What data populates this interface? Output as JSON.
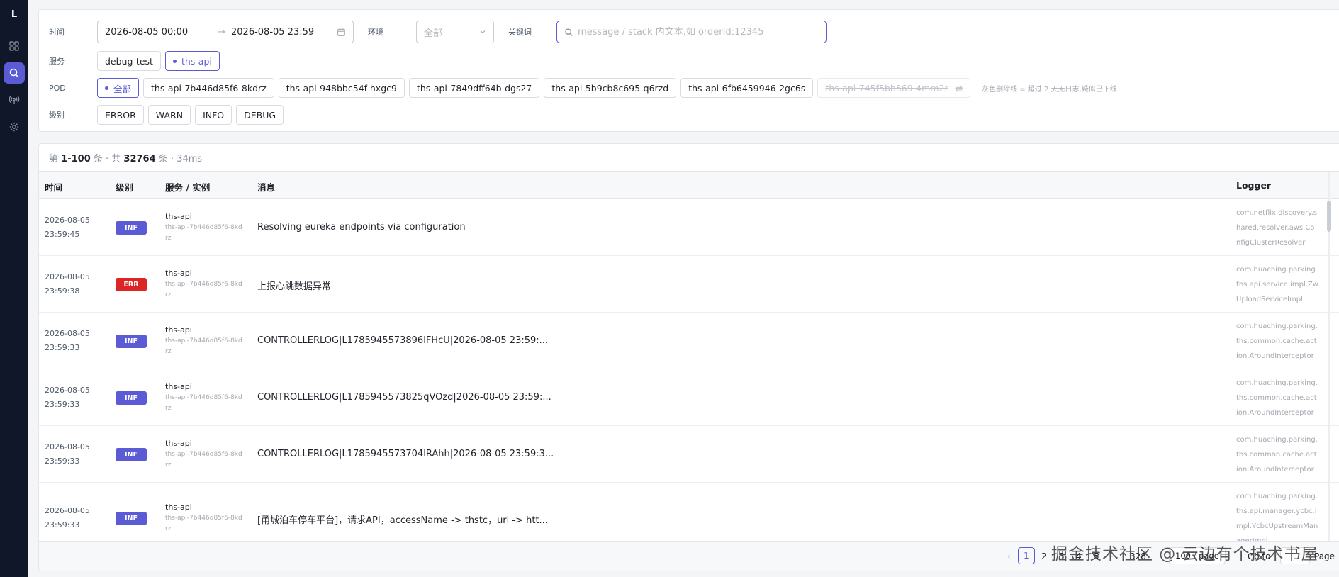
{
  "sidebar": {
    "logo": "L",
    "items": [
      {
        "icon": "grid-icon",
        "active": false
      },
      {
        "icon": "search-icon",
        "active": true
      },
      {
        "icon": "broadcast-icon",
        "active": false
      },
      {
        "icon": "gear-icon",
        "active": false
      }
    ]
  },
  "filters": {
    "time_label": "时间",
    "time_start": "2026-08-05 00:00",
    "time_end": "2026-08-05 23:59",
    "range_arrow": "→",
    "env_label": "环境",
    "env_value": "全部",
    "keyword_label": "关键词",
    "keyword_placeholder": "message / stack 内文本,如 orderId:12345",
    "service_label": "服务",
    "services": [
      {
        "label": "debug-test",
        "active": false
      },
      {
        "label": "ths-api",
        "active": true
      }
    ],
    "pod_label": "POD",
    "pods": [
      {
        "label": "全部",
        "active": true
      },
      {
        "label": "ths-api-7b446d85f6-8kdrz",
        "active": false
      },
      {
        "label": "ths-api-948bbc54f-hxgc9",
        "active": false
      },
      {
        "label": "ths-api-7849dff64b-dgs27",
        "active": false
      },
      {
        "label": "ths-api-5b9cb8c695-q6rzd",
        "active": false
      },
      {
        "label": "ths-api-6fb6459946-2gc6s",
        "active": false
      }
    ],
    "pod_faded": "ths-api-745f5bb569-4mm2r",
    "pod_hint": "灰色删除线 = 超过 2 天无日志,疑似已下线",
    "level_label": "级别",
    "levels": [
      "ERROR",
      "WARN",
      "INFO",
      "DEBUG"
    ]
  },
  "summary": {
    "prefix": "第",
    "range": "1-100",
    "mid": "条 · 共",
    "total": "32764",
    "suffix": "条 · 34ms"
  },
  "table": {
    "headers": {
      "time": "时间",
      "level": "级别",
      "service": "服务 / 实例",
      "message": "消息",
      "logger": "Logger"
    },
    "rows": [
      {
        "date": "2026-08-05",
        "clock": "23:59:45",
        "level": "INF",
        "service": "ths-api",
        "instance": "ths-api-7b446d85f6-8kdrz",
        "message": "Resolving eureka endpoints via configuration",
        "logger": "com.netflix.discovery.shared.resolver.aws.ConfigClusterResolver"
      },
      {
        "date": "2026-08-05",
        "clock": "23:59:38",
        "level": "ERR",
        "service": "ths-api",
        "instance": "ths-api-7b446d85f6-8kdrz",
        "message": "上报心跳数据异常",
        "logger": "com.huaching.parking.ths.api.service.impl.ZwUploadServiceImpl"
      },
      {
        "date": "2026-08-05",
        "clock": "23:59:33",
        "level": "INF",
        "service": "ths-api",
        "instance": "ths-api-7b446d85f6-8kdrz",
        "message": "CONTROLLERLOG|L1785945573896lFHcU|2026-08-05 23:59:...",
        "logger": "com.huaching.parking.ths.common.cache.action.AroundInterceptor"
      },
      {
        "date": "2026-08-05",
        "clock": "23:59:33",
        "level": "INF",
        "service": "ths-api",
        "instance": "ths-api-7b446d85f6-8kdrz",
        "message": "CONTROLLERLOG|L1785945573825qVOzd|2026-08-05 23:59:...",
        "logger": "com.huaching.parking.ths.common.cache.action.AroundInterceptor"
      },
      {
        "date": "2026-08-05",
        "clock": "23:59:33",
        "level": "INF",
        "service": "ths-api",
        "instance": "ths-api-7b446d85f6-8kdrz",
        "message": "CONTROLLERLOG|L1785945573704lRAhh|2026-08-05 23:59:3...",
        "logger": "com.huaching.parking.ths.common.cache.action.AroundInterceptor"
      },
      {
        "date": "2026-08-05",
        "clock": "23:59:33",
        "level": "INF",
        "service": "ths-api",
        "instance": "ths-api-7b446d85f6-8kdrz",
        "message": "[甬城泊车停车平台]，请求API，accessName -> thstc，url -> htt...",
        "logger": "com.huaching.parking.ths.api.manager.ycbc.impl.YcbcUpstreamManagerImpl"
      }
    ]
  },
  "pagination": {
    "prev": "‹",
    "pages": [
      "1",
      "2",
      "3",
      "4",
      "5"
    ],
    "current": "1",
    "ellipsis": "···",
    "last": "328",
    "page_size": "100 / page",
    "goto_label": "Go to",
    "goto_suffix": "Page"
  },
  "watermark": "掘金技术社区 @ 云边有个技术书屋",
  "colors": {
    "accent": "#5b5bd6",
    "error": "#dc2626",
    "sidebar": "#0f1729"
  }
}
